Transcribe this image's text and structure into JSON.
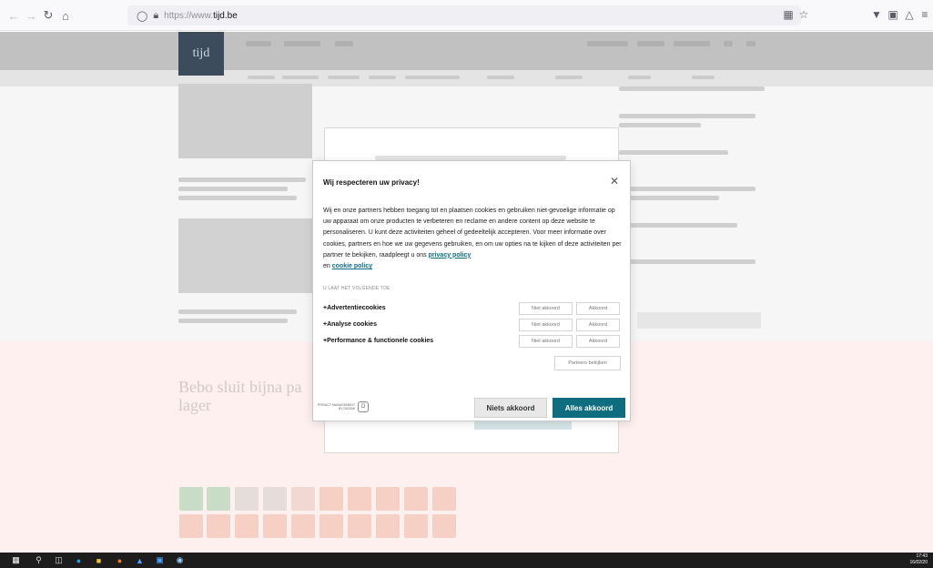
{
  "browser": {
    "url_prefix": "https://www.",
    "url_domain": "tijd.be",
    "icons": [
      "back-icon",
      "forward-icon",
      "reload-icon",
      "home-icon",
      "shield-icon",
      "lock-icon",
      "translate-icon",
      "bookmark-star-icon",
      "pocket-icon",
      "extensions-icon",
      "account-icon",
      "menu-icon"
    ]
  },
  "site": {
    "logo": "tijd",
    "ghost_headline": "Bebo sluit bijna pa",
    "ghost_headline_2": "lager"
  },
  "consent": {
    "title": "Wij respecteren uw privacy!",
    "body": "Wij en onze partners hebben toegang tot en plaatsen cookies en gebruiken niet-gevoelige informatie op uw apparaat om onze producten te verbeteren en reclame en andere content op deze website te personaliseren. U kunt deze activiteiten geheel of gedeeltelijk accepteren. Voor meer informatie over cookies, partners en hoe we uw gegevens gebruiken, en om uw opties na te kijken of deze activiteiten per partner te bekijken, raadpleegt u ons",
    "privacy_link": "privacy policy",
    "conjunction": "en",
    "cookie_link": "cookie policy",
    "section_label": "U LAAT HET VOLGENDE TOE",
    "preferences": [
      {
        "label": "Advertentiecookies",
        "decline": "Niet akkoord",
        "accept": "Akkoord"
      },
      {
        "label": "Analyse cookies",
        "decline": "Niet akkoord",
        "accept": "Akkoord"
      },
      {
        "label": "Performance & functionele cookies",
        "decline": "Niet akkoord",
        "accept": "Akkoord"
      }
    ],
    "partners_button": "Partners bekijken",
    "powered_by_line1": "PRIVACY MANAGEMENT",
    "powered_by_line2": "BY DIDOMI",
    "decline_all": "Niets akkoord",
    "accept_all": "Alles akkoord"
  },
  "taskbar": {
    "time": "17:43",
    "date": "16/02/20"
  }
}
